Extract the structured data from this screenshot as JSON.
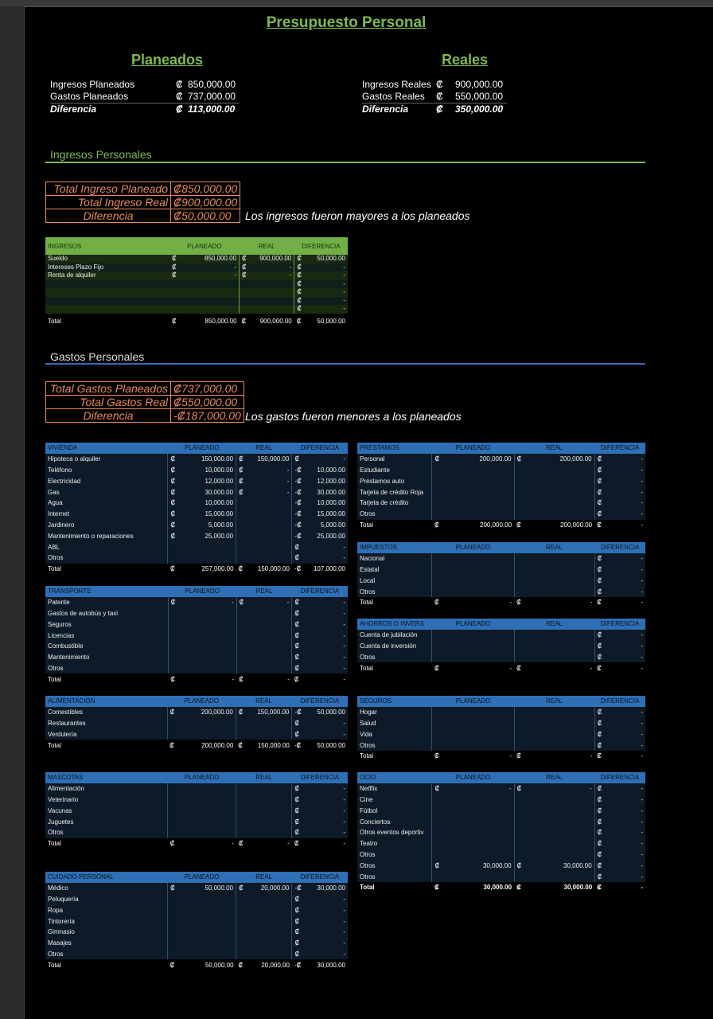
{
  "title": "Presupuesto Personal",
  "planeados": {
    "heading": "Planeados",
    "rows": [
      {
        "label": "Ingresos Planeados",
        "cur": "₡",
        "value": "850,000.00"
      },
      {
        "label": "Gastos Planeados",
        "cur": "₡",
        "value": "737,000.00"
      },
      {
        "label": "Diferencia",
        "cur": "₡",
        "value": "113,000.00"
      }
    ]
  },
  "reales": {
    "heading": "Reales",
    "rows": [
      {
        "label": "Ingresos Reales",
        "cur": "₡",
        "value": "900,000.00"
      },
      {
        "label": "Gastos Reales",
        "cur": "₡",
        "value": "550,000.00"
      },
      {
        "label": "Diferencia",
        "cur": "₡",
        "value": "350,000.00"
      }
    ]
  },
  "ingresos_section": {
    "heading": "Ingresos Personales",
    "summary": [
      {
        "label": "Total Ingreso Planeado",
        "value": "₡850,000.00"
      },
      {
        "label": "Total Ingreso Real",
        "value": "₡900,000.00"
      },
      {
        "label": "Diferencia",
        "value": "₡50,000.00"
      }
    ],
    "note": "Los ingresos fueron mayores a los planeados",
    "table": {
      "headers": [
        "INGRESOS",
        "PLANEADO",
        "REAL",
        "DIFERENCIA"
      ],
      "rows": [
        [
          "Sueldo",
          "₡",
          "850,000.00",
          "₡",
          "900,000.00",
          "₡",
          "50,000.00"
        ],
        [
          "Intereses Plazo Fijo",
          "₡",
          "-",
          "₡",
          "-",
          "₡",
          "-"
        ],
        [
          "Renta de alquiler",
          "₡",
          "-",
          "₡",
          "-",
          "₡",
          "-"
        ],
        [
          "",
          "",
          "",
          "",
          "",
          "₡",
          "-"
        ],
        [
          "",
          "",
          "",
          "",
          "",
          "₡",
          "-"
        ],
        [
          "",
          "",
          "",
          "",
          "",
          "₡",
          "-"
        ],
        [
          "",
          "",
          "",
          "",
          "",
          "₡",
          "-"
        ]
      ],
      "total": [
        "Total",
        "₡",
        "850,000.00",
        "₡",
        "900,000.00",
        "₡",
        "50,000.00"
      ]
    }
  },
  "gastos_section": {
    "heading": "Gastos Personales",
    "summary": [
      {
        "label": "Total Gastos Planeados",
        "value": "₡737,000.00"
      },
      {
        "label": "Total Gastos Real",
        "value": "₡550,000.00"
      },
      {
        "label": "Diferencia",
        "value": "-₡187,000.00"
      }
    ],
    "note": "Los gastos fueron menores a los planeados"
  },
  "tables": {
    "vivienda": {
      "headers": [
        "VIVIENDA",
        "PLANEADO",
        "REAL",
        "DIFERENCIA"
      ],
      "rows": [
        [
          "Hipoteca o alquiler",
          "₡",
          "150,000.00",
          "₡",
          "150,000.00",
          "₡",
          "-"
        ],
        [
          "Teléfono",
          "₡",
          "10,000.00",
          "₡",
          "-",
          "-₡",
          "10,000.00"
        ],
        [
          "Electricidad",
          "₡",
          "12,000.00",
          "₡",
          "-",
          "-₡",
          "12,000.00"
        ],
        [
          "Gas",
          "₡",
          "30,000.00",
          "₡",
          "-",
          "-₡",
          "30,000.00"
        ],
        [
          "Agua",
          "₡",
          "10,000.00",
          "",
          "",
          "-₡",
          "10,000.00"
        ],
        [
          "Internet",
          "₡",
          "15,000.00",
          "",
          "",
          "-₡",
          "15,000.00"
        ],
        [
          "Jardinero",
          "₡",
          "5,000.00",
          "",
          "",
          "-₡",
          "5,000.00"
        ],
        [
          "Mantenimiento o reparaciones",
          "₡",
          "25,000.00",
          "",
          "",
          "-₡",
          "25,000.00"
        ],
        [
          "ABL",
          "",
          "",
          "",
          "",
          "₡",
          "-"
        ],
        [
          "Otros",
          "",
          "",
          "",
          "",
          "₡",
          "-"
        ]
      ],
      "total": [
        "Total",
        "₡",
        "257,000.00",
        "₡",
        "150,000.00",
        "-₡",
        "107,000.00"
      ]
    },
    "transporte": {
      "headers": [
        "TRANSPORTE",
        "PLANEADO",
        "REAL",
        "DIFERENCIA"
      ],
      "rows": [
        [
          "Patente",
          "₡",
          "-",
          "₡",
          "-",
          "₡",
          "-"
        ],
        [
          "Gastos de autobús y taxi",
          "",
          "",
          "",
          "",
          "₡",
          "-"
        ],
        [
          "Seguros",
          "",
          "",
          "",
          "",
          "₡",
          "-"
        ],
        [
          "Licencias",
          "",
          "",
          "",
          "",
          "₡",
          "-"
        ],
        [
          "Combustible",
          "",
          "",
          "",
          "",
          "₡",
          "-"
        ],
        [
          "Mantenimiento",
          "",
          "",
          "",
          "",
          "₡",
          "-"
        ],
        [
          "Otros",
          "",
          "",
          "",
          "",
          "₡",
          "-"
        ]
      ],
      "total": [
        "Total",
        "₡",
        "-",
        "₡",
        "-",
        "₡",
        "-"
      ]
    },
    "alimentacion": {
      "headers": [
        "ALIMENTACIÓN",
        "PLANEADO",
        "REAL",
        "DIFERENCIA"
      ],
      "rows": [
        [
          "Comestibles",
          "₡",
          "200,000.00",
          "₡",
          "150,000.00",
          "-₡",
          "50,000.00"
        ],
        [
          "Restaurantes",
          "",
          "",
          "",
          "",
          "₡",
          "-"
        ],
        [
          "Verdulería",
          "",
          "",
          "",
          "",
          "₡",
          "-"
        ]
      ],
      "total": [
        "Total",
        "₡",
        "200,000.00",
        "₡",
        "150,000.00",
        "-₡",
        "50,000.00"
      ]
    },
    "mascotas": {
      "headers": [
        "MASCOTAS",
        "PLANEADO",
        "REAL",
        "DIFERENCIA"
      ],
      "rows": [
        [
          "Alimentación",
          "",
          "",
          "",
          "",
          "₡",
          "-"
        ],
        [
          "Veterinario",
          "",
          "",
          "",
          "",
          "₡",
          "-"
        ],
        [
          "Vacunas",
          "",
          "",
          "",
          "",
          "₡",
          "-"
        ],
        [
          "Juguetes",
          "",
          "",
          "",
          "",
          "₡",
          "-"
        ],
        [
          "Otros",
          "",
          "",
          "",
          "",
          "₡",
          "-"
        ]
      ],
      "total": [
        "Total",
        "₡",
        "-",
        "₡",
        "-",
        "₡",
        "-"
      ]
    },
    "cuidado": {
      "headers": [
        "CUIDADO PERSONAL",
        "PLANEADO",
        "REAL",
        "DIFERENCIA"
      ],
      "rows": [
        [
          "Médico",
          "₡",
          "50,000.00",
          "₡",
          "20,000.00",
          "-₡",
          "30,000.00"
        ],
        [
          "Peluquería",
          "",
          "",
          "",
          "",
          "₡",
          "-"
        ],
        [
          "Ropa",
          "",
          "",
          "",
          "",
          "₡",
          "-"
        ],
        [
          "Tintorería",
          "",
          "",
          "",
          "",
          "₡",
          "-"
        ],
        [
          "Gimnasio",
          "",
          "",
          "",
          "",
          "₡",
          "-"
        ],
        [
          "Masajes",
          "",
          "",
          "",
          "",
          "₡",
          "-"
        ],
        [
          "Otros",
          "",
          "",
          "",
          "",
          "₡",
          "-"
        ]
      ],
      "total": [
        "Total",
        "₡",
        "50,000.00",
        "₡",
        "20,000.00",
        "-₡",
        "30,000.00"
      ]
    },
    "prestamos": {
      "headers": [
        "PRÉSTAMOS",
        "PLANEADO",
        "REAL",
        "DIFERENCIA"
      ],
      "rows": [
        [
          "Personal",
          "₡",
          "200,000.00",
          "₡",
          "200,000.00",
          "₡",
          "-"
        ],
        [
          "Estudiante",
          "",
          "",
          "",
          "",
          "₡",
          "-"
        ],
        [
          "Préstamos auto",
          "",
          "",
          "",
          "",
          "₡",
          "-"
        ],
        [
          "Tarjeta de crédito Roja",
          "",
          "",
          "",
          "",
          "₡",
          "-"
        ],
        [
          "Tarjeta de crédito",
          "",
          "",
          "",
          "",
          "₡",
          "-"
        ],
        [
          "Otros",
          "",
          "",
          "",
          "",
          "₡",
          "-"
        ]
      ],
      "total": [
        "Total",
        "₡",
        "200,000.00",
        "₡",
        "200,000.00",
        "₡",
        "-"
      ]
    },
    "impuestos": {
      "headers": [
        "IMPUESTOS",
        "PLANEADO",
        "REAL",
        "DIFERENCIA"
      ],
      "rows": [
        [
          "Nacional",
          "",
          "",
          "",
          "",
          "₡",
          "-"
        ],
        [
          "Estatal",
          "",
          "",
          "",
          "",
          "₡",
          "-"
        ],
        [
          "Local",
          "",
          "",
          "",
          "",
          "₡",
          "-"
        ],
        [
          "Otros",
          "",
          "",
          "",
          "",
          "₡",
          "-"
        ]
      ],
      "total": [
        "Total",
        "₡",
        "-",
        "₡",
        "-",
        "₡",
        "-"
      ]
    },
    "ahorros": {
      "headers": [
        "AHORROS O INVERS",
        "PLANEADO",
        "REAL",
        "DIFERENCIA"
      ],
      "rows": [
        [
          "Cuenta de jubilación",
          "",
          "",
          "",
          "",
          "₡",
          "-"
        ],
        [
          "Cuenta de inversión",
          "",
          "",
          "",
          "",
          "₡",
          "-"
        ],
        [
          "Otros",
          "",
          "",
          "",
          "",
          "₡",
          "-"
        ]
      ],
      "total": [
        "Total",
        "₡",
        "-",
        "₡",
        "-",
        "₡",
        "-"
      ]
    },
    "seguros": {
      "headers": [
        "SEGUROS",
        "PLANEADO",
        "REAL",
        "DIFERENCIA"
      ],
      "rows": [
        [
          "Hogar",
          "",
          "",
          "",
          "",
          "₡",
          "-"
        ],
        [
          "Salud",
          "",
          "",
          "",
          "",
          "₡",
          "-"
        ],
        [
          "Vida",
          "",
          "",
          "",
          "",
          "₡",
          "-"
        ],
        [
          "Otros",
          "",
          "",
          "",
          "",
          "₡",
          "-"
        ]
      ],
      "total": [
        "Total",
        "₡",
        "-",
        "₡",
        "-",
        "₡",
        "-"
      ]
    },
    "ocio": {
      "headers": [
        "OCIO",
        "PLANEADO",
        "REAL",
        "DIFERENCIA"
      ],
      "rows": [
        [
          "Netflix",
          "₡",
          "-",
          "₡",
          "-",
          "₡",
          "-"
        ],
        [
          "Cine",
          "",
          "",
          "",
          "",
          "₡",
          "-"
        ],
        [
          "Fútbol",
          "",
          "",
          "",
          "",
          "₡",
          "-"
        ],
        [
          "Conciertos",
          "",
          "",
          "",
          "",
          "₡",
          "-"
        ],
        [
          "Otros eventos deportiv",
          "",
          "",
          "",
          "",
          "₡",
          "-"
        ],
        [
          "Teatro",
          "",
          "",
          "",
          "",
          "₡",
          "-"
        ],
        [
          "Otros",
          "",
          "",
          "",
          "",
          "₡",
          "-"
        ],
        [
          "Otros",
          "₡",
          "30,000.00",
          "₡",
          "30,000.00",
          "₡",
          "-"
        ],
        [
          "Otros",
          "",
          "",
          "",
          "",
          "₡",
          "-"
        ]
      ],
      "total": [
        "Total",
        "₡",
        "30,000.00",
        "₡",
        "30,000.00",
        "₡",
        "-"
      ]
    }
  }
}
